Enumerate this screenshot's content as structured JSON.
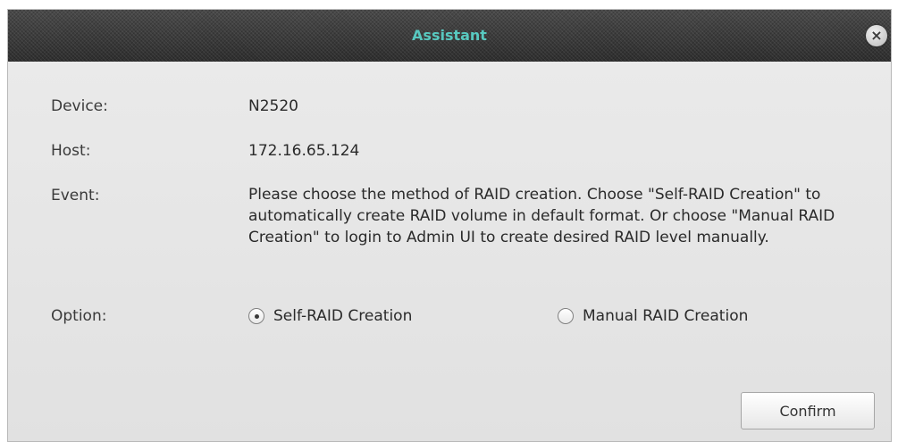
{
  "dialog": {
    "title": "Assistant",
    "close_symbol": "×"
  },
  "fields": {
    "device_label": "Device:",
    "device_value": "N2520",
    "host_label": "Host:",
    "host_value": "172.16.65.124",
    "event_label": "Event:",
    "event_value": "Please choose the method of RAID creation. Choose \"Self-RAID Creation\" to automatically create RAID volume in default format. Or choose \"Manual RAID Creation\" to login to Admin UI to create desired RAID level manually.",
    "option_label": "Option:"
  },
  "options": [
    {
      "label": "Self-RAID Creation",
      "selected": true
    },
    {
      "label": "Manual RAID Creation",
      "selected": false
    }
  ],
  "buttons": {
    "confirm_label": "Confirm"
  },
  "icons": {
    "close": "close-icon",
    "radio_selected": "radio-selected-icon",
    "radio_unselected": "radio-unselected-icon"
  },
  "colors": {
    "title_text": "#58c9c0",
    "titlebar_bg": "#3d3d3d",
    "dialog_bg": "#e6e6e6"
  }
}
